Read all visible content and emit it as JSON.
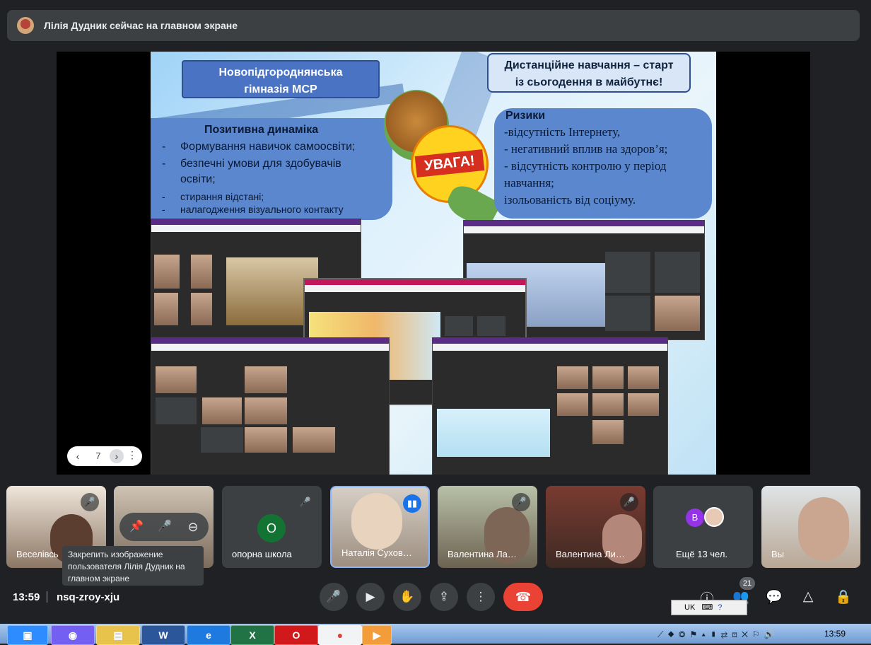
{
  "banner": {
    "text": "Лілія Дудник сейчас на главном экране"
  },
  "slide": {
    "school": [
      "Новопідгороднянська",
      "гімназія МСР"
    ],
    "motto": [
      "Дистанційне навчання – старт",
      "із сьогодення в майбутнє!"
    ],
    "positive_title": "Позитивна динаміка",
    "positive_items": [
      "Формування навичок самоосвіти;",
      "безпечні умови для здобувачів освіти;",
      "стирання відстані;",
      "налагодження візуального контакту"
    ],
    "risks_title": "Ризики",
    "risks_items": [
      "-відсутність Інтернету,",
      "- негативний вплив на здоров’я;",
      "- відсутність контролю у період навчання;",
      "ізольованість від соціуму."
    ],
    "attention": "УВАГА!"
  },
  "pager": {
    "page": "7"
  },
  "tooltip": {
    "text": "Закрепить изображение пользователя Лілія Дудник на главном экране"
  },
  "participants": [
    {
      "name": "Веселівсь",
      "muted": true
    },
    {
      "name": ""
    },
    {
      "name": "опорна школа",
      "initial": "О",
      "muted": true
    },
    {
      "name": "Наталія Сухов…",
      "speaking": true
    },
    {
      "name": "Валентина Ла…",
      "muted": true
    },
    {
      "name": "Валентина Ли…",
      "muted": true
    },
    {
      "name": "Ещё 13 чел.",
      "initial": "В"
    },
    {
      "name": "Вы"
    }
  ],
  "meeting": {
    "time": "13:59",
    "code": "nsq-zroy-xju",
    "people_count": "21"
  },
  "taskbar": {
    "clock": "13:59",
    "lang": "UK"
  }
}
